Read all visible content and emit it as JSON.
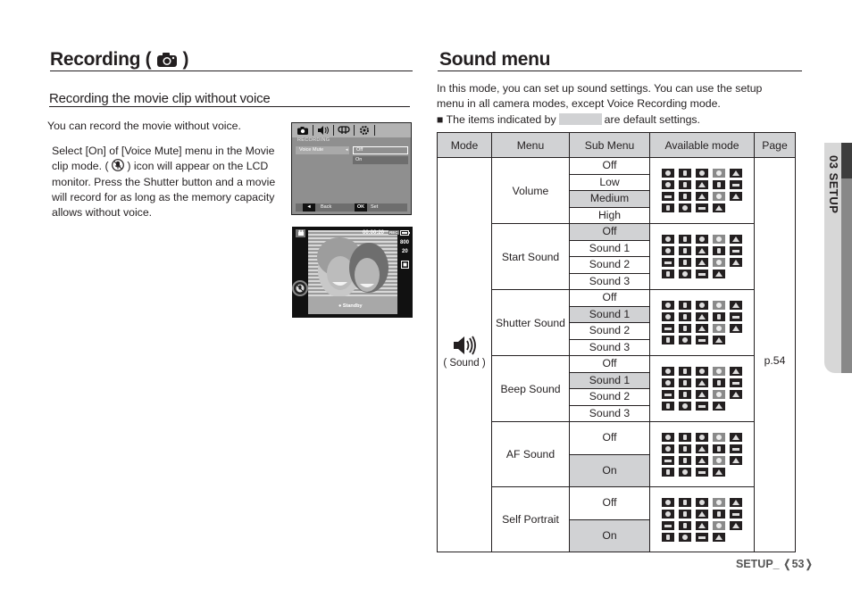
{
  "left": {
    "title_prefix": "Recording (",
    "title_suffix": ")",
    "title_icon": "camera-icon",
    "subtitle": "Recording the movie clip without voice",
    "intro": "You can record the movie without voice.",
    "para_part1": "Select [On] of [Voice Mute] menu in the Movie clip mode. (",
    "para_icon": "voice-mute-icon",
    "para_part2": ") icon will appear on the LCD monitor. Press the Shutter button and a movie will record for as long as the memory capacity allows without voice.",
    "lcd_menu": {
      "tabs": [
        "camera-icon",
        "sound-icon",
        "display-icon",
        "settings-icon"
      ],
      "section": "RECORDING",
      "item": "Voice Mute",
      "options": [
        "Off",
        "On"
      ],
      "selected_option": "Off",
      "footer_back_key": "◄",
      "footer_back": "Back",
      "footer_ok_key": "OK",
      "footer_set": "Set"
    },
    "lcd_live": {
      "mode_icon": "movie-mode-icon",
      "timer": "00:00:20",
      "rec_badge": "REC",
      "battery_icon": "battery-icon",
      "resolution": "800",
      "fps": "20",
      "quality_icon": "quality-icon",
      "voice_mute_icon": "voice-mute-icon",
      "status": "Standby"
    }
  },
  "right": {
    "title": "Sound menu",
    "intro_line1": "In this mode, you can set up sound settings. You can use the setup",
    "intro_line2": "menu in all camera modes, except Voice Recording mode.",
    "legend_prefix": "■ The items indicated by",
    "legend_suffix": "are default settings.",
    "table": {
      "headers": [
        "Mode",
        "Menu",
        "Sub Menu",
        "Available mode",
        "Page"
      ],
      "mode_icon": "speaker-icon",
      "mode_label": "( Sound )",
      "page": "p.54",
      "menus": [
        {
          "name": "Volume",
          "subs": [
            "Off",
            "Low",
            "Medium",
            "High"
          ],
          "default": "Medium"
        },
        {
          "name": "Start Sound",
          "subs": [
            "Off",
            "Sound 1",
            "Sound 2",
            "Sound 3"
          ],
          "default": "Off"
        },
        {
          "name": "Shutter Sound",
          "subs": [
            "Off",
            "Sound 1",
            "Sound 2",
            "Sound 3"
          ],
          "default": "Sound 1"
        },
        {
          "name": "Beep Sound",
          "subs": [
            "Off",
            "Sound 1",
            "Sound 2",
            "Sound 3"
          ],
          "default": "Sound 1"
        },
        {
          "name": "AF Sound",
          "subs": [
            "Off",
            "On"
          ],
          "default": "On"
        },
        {
          "name": "Self Portrait",
          "subs": [
            "Off",
            "On"
          ],
          "default": "On"
        }
      ],
      "available_mode_icons": [
        "auto-icon",
        "program-icon",
        "dual-is-icon",
        "smart-auto-icon",
        "night-icon",
        "beauty-shot-icon",
        "portrait-icon",
        "landscape-icon",
        "close-up-icon",
        "text-icon",
        "sunset-icon",
        "dawn-icon",
        "backlight-icon",
        "firework-icon",
        "beach-snow-icon",
        "self-shot-icon",
        "food-icon",
        "cafe-icon",
        "movie-icon"
      ]
    }
  },
  "side_tab": {
    "label": "03 SETUP"
  },
  "footer": {
    "text": "SETUP_ ❬53❭"
  }
}
